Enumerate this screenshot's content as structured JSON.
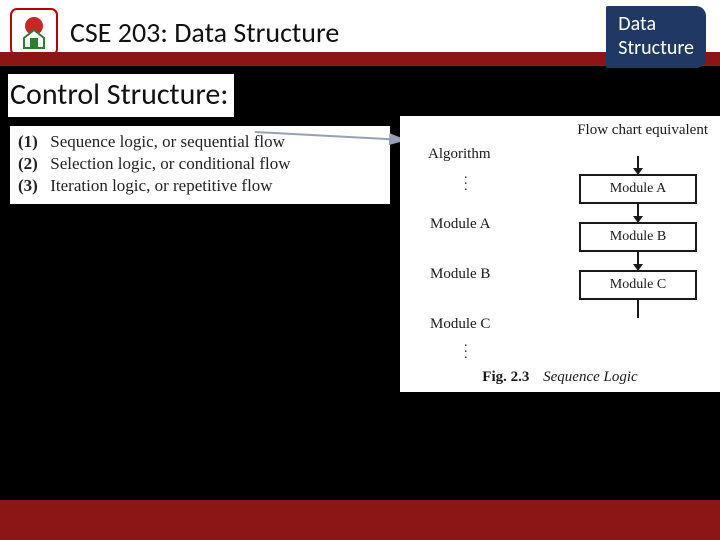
{
  "header": {
    "course_title": "CSE 203: Data Structure",
    "badge": "Data\nStructure",
    "logo_name": "university-emblem"
  },
  "section_title": "Control Structure:",
  "logic_list": [
    {
      "num": "(1)",
      "text": "Sequence logic, or sequential flow"
    },
    {
      "num": "(2)",
      "text": "Selection logic, or conditional flow"
    },
    {
      "num": "(3)",
      "text": "Iteration logic, or repetitive flow"
    }
  ],
  "diagram": {
    "flowchart_header": "Flow chart equivalent",
    "algorithm_header": "Algorithm",
    "alg_items": [
      "Module A",
      "Module B",
      "Module C"
    ],
    "fc_items": [
      "Module A",
      "Module B",
      "Module C"
    ],
    "caption_no": "Fig. 2.3",
    "caption_text": "Sequence Logic"
  }
}
